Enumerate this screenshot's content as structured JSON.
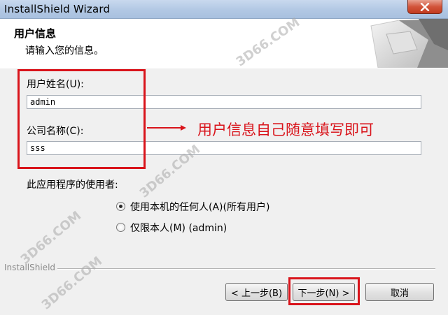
{
  "window": {
    "title": "InstallShield Wizard"
  },
  "header": {
    "title": "用户信息",
    "subtitle": "请输入您的信息。"
  },
  "form": {
    "username_label": "用户姓名(U):",
    "username_value": "admin",
    "company_label": "公司名称(C):",
    "company_value": "sss",
    "users_label": "此应用程序的使用者:",
    "option_anyone": "使用本机的任何人(A)(所有用户)",
    "option_only_me": "仅限本人(M) (admin)",
    "selected_option": "option_anyone"
  },
  "annotation": {
    "text": "用户信息自己随意填写即可",
    "color": "#d9141b"
  },
  "footer": {
    "brand": "InstallShield",
    "back_label": "< 上一步(B)",
    "next_label": "下一步(N) >",
    "cancel_label": "取消"
  },
  "watermarks": {
    "site": "3D66.COM"
  }
}
